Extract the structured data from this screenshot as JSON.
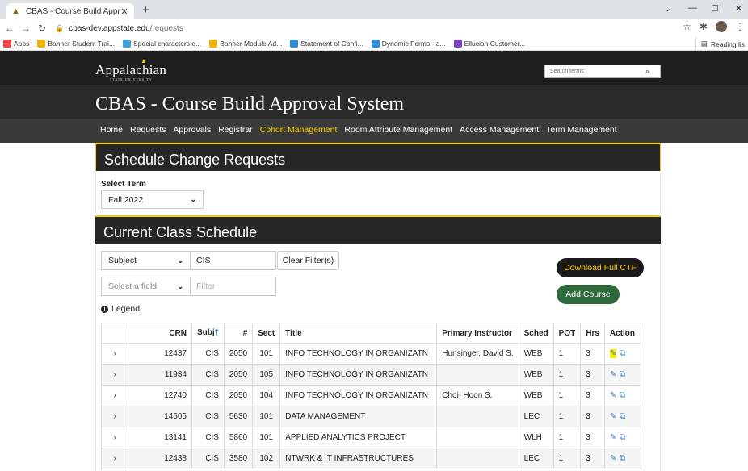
{
  "browser": {
    "tab_title": "CBAS - Course Build Approval Sy",
    "url_host": "cbas-dev.appstate.edu",
    "url_path": "/requests",
    "bookmarks": [
      {
        "label": "Apps",
        "color": "#e44"
      },
      {
        "label": "Banner Student Trai...",
        "color": "#f0b400"
      },
      {
        "label": "Special characters e...",
        "color": "#3aa0e0"
      },
      {
        "label": "Banner Module Ad...",
        "color": "#f0b400"
      },
      {
        "label": "Statement of Confi...",
        "color": "#2a8fd8"
      },
      {
        "label": "Dynamic Forms - a...",
        "color": "#2a8fd8"
      },
      {
        "label": "Ellucian Customer...",
        "color": "#7b3fc4"
      }
    ],
    "reading_list": "Reading lis"
  },
  "site": {
    "logo": "Appalachian",
    "logo_sub": "STATE UNIVERSITY",
    "search_placeholder": "Search terms",
    "title": "CBAS - Course Build Approval System",
    "nav": [
      {
        "label": "Home",
        "active": false
      },
      {
        "label": "Requests",
        "active": false
      },
      {
        "label": "Approvals",
        "active": false
      },
      {
        "label": "Registrar",
        "active": false
      },
      {
        "label": "Cohort Management",
        "active": true
      },
      {
        "label": "Room Attribute Management",
        "active": false
      },
      {
        "label": "Access Management",
        "active": false
      },
      {
        "label": "Term Management",
        "active": false
      }
    ]
  },
  "schedule_change": {
    "heading": "Schedule Change Requests",
    "term_label": "Select Term",
    "term_value": "Fall 2022"
  },
  "current_schedule": {
    "heading": "Current Class Schedule",
    "filter1_field": "Subject",
    "filter1_value": "CIS",
    "filter2_field": "Select a field",
    "filter2_placeholder": "Filter",
    "clear_button": "Clear Filter(s)",
    "download_button": "Download Full CTF",
    "add_button": "Add Course",
    "legend": "Legend",
    "columns": [
      "",
      "CRN",
      "Subj",
      "#",
      "Sect",
      "Title",
      "Primary Instructor",
      "Sched",
      "POT",
      "Hrs",
      "Action"
    ],
    "rows": [
      {
        "crn": "12437",
        "subj": "CIS",
        "num": "2050",
        "sect": "101",
        "title": "INFO TECHNOLOGY IN ORGANIZATN",
        "instructor": "Hunsinger, David S.",
        "sched": "WEB",
        "pot": "1",
        "hrs": "3"
      },
      {
        "crn": "11934",
        "subj": "CIS",
        "num": "2050",
        "sect": "105",
        "title": "INFO TECHNOLOGY IN ORGANIZATN",
        "instructor": "",
        "sched": "WEB",
        "pot": "1",
        "hrs": "3"
      },
      {
        "crn": "12740",
        "subj": "CIS",
        "num": "2050",
        "sect": "104",
        "title": "INFO TECHNOLOGY IN ORGANIZATN",
        "instructor": "Choi, Hoon S.",
        "sched": "WEB",
        "pot": "1",
        "hrs": "3"
      },
      {
        "crn": "14605",
        "subj": "CIS",
        "num": "5630",
        "sect": "101",
        "title": "DATA MANAGEMENT",
        "instructor": "",
        "sched": "LEC",
        "pot": "1",
        "hrs": "3"
      },
      {
        "crn": "13141",
        "subj": "CIS",
        "num": "5860",
        "sect": "101",
        "title": "APPLIED ANALYTICS PROJECT",
        "instructor": "",
        "sched": "WLH",
        "pot": "1",
        "hrs": "3"
      },
      {
        "crn": "12438",
        "subj": "CIS",
        "num": "3580",
        "sect": "102",
        "title": "NTWRK & IT INFRASTRUCTURES",
        "instructor": "",
        "sched": "LEC",
        "pot": "1",
        "hrs": "3"
      }
    ]
  }
}
